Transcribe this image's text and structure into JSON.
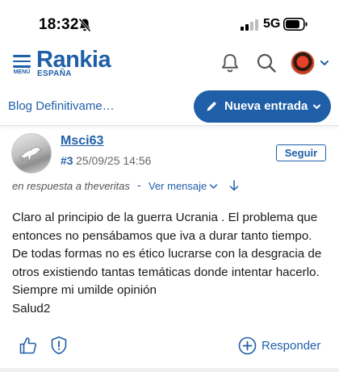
{
  "status_bar": {
    "time": "18:32",
    "network": "5G",
    "icons": [
      "bell-off-icon",
      "signal-icon",
      "battery-icon"
    ]
  },
  "header": {
    "menu_label": "MENÚ",
    "logo": "Rankia",
    "logo_sub": "ESPAÑA",
    "icons": [
      "bell-icon",
      "search-icon",
      "avatar",
      "chevron-down-icon"
    ]
  },
  "subnav": {
    "blog_title": "Blog Definitivame…",
    "new_entry_label": "Nueva entrada"
  },
  "post": {
    "author": "Msci63",
    "number": "#3",
    "date": "25/09/25 14:56",
    "follow_label": "Seguir",
    "reply_to": "en respuesta a theveritas",
    "reply_dash": "-",
    "view_message_label": "Ver mensaje",
    "body_lines": [
      "Claro al principio de la guerra Ucrania . El problema que",
      "entonces no pensábamos que iva a durar tanto tiempo.",
      "De todas formas no es ético lucrarse con la desgracia de",
      "otros existiendo tantas temáticas donde intentar hacerlo.",
      "Siempre mi umilde opinión",
      "Salud2"
    ],
    "reply_label": "Responder"
  },
  "colors": {
    "brand": "#1f5fa8",
    "text": "#1a1a1a",
    "muted": "#666666"
  }
}
